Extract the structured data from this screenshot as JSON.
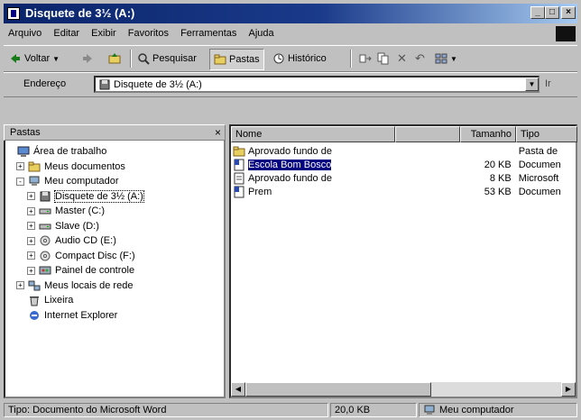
{
  "window": {
    "title": "Disquete de 3½ (A:)"
  },
  "titlebar_buttons": {
    "minimize": "_",
    "maximize": "□",
    "close": "×"
  },
  "menu": [
    "Arquivo",
    "Editar",
    "Exibir",
    "Favoritos",
    "Ferramentas",
    "Ajuda"
  ],
  "toolbar": {
    "back": "Voltar",
    "pesquisar": "Pesquisar",
    "pastas": "Pastas",
    "historico": "Histórico"
  },
  "address": {
    "label": "Endereço",
    "value": "Disquete de 3½ (A:)",
    "go": "Ir"
  },
  "folders_panel": {
    "title": "Pastas",
    "close": "×",
    "items": [
      {
        "label": "Área de trabalho",
        "icon": "desktop-icon",
        "level": 0,
        "expander": ""
      },
      {
        "label": "Meus documentos",
        "icon": "folder-icon",
        "level": 1,
        "expander": "+"
      },
      {
        "label": "Meu computador",
        "icon": "computer-icon",
        "level": 1,
        "expander": "-"
      },
      {
        "label": "Disquete de 3½ (A:)",
        "icon": "floppy-icon",
        "level": 2,
        "expander": "+"
      },
      {
        "label": "Master (C:)",
        "icon": "drive-icon",
        "level": 2,
        "expander": "+"
      },
      {
        "label": "Slave (D:)",
        "icon": "drive-icon",
        "level": 2,
        "expander": "+"
      },
      {
        "label": "Audio CD (E:)",
        "icon": "cd-icon",
        "level": 2,
        "expander": "+"
      },
      {
        "label": "Compact Disc (F:)",
        "icon": "cd-icon",
        "level": 2,
        "expander": "+"
      },
      {
        "label": "Painel de controle",
        "icon": "control-panel-icon",
        "level": 2,
        "expander": "+"
      },
      {
        "label": "Meus locais de rede",
        "icon": "network-icon",
        "level": 1,
        "expander": "+"
      },
      {
        "label": "Lixeira",
        "icon": "recycle-bin-icon",
        "level": 1,
        "expander": ""
      },
      {
        "label": "Internet Explorer",
        "icon": "ie-icon",
        "level": 1,
        "expander": ""
      }
    ]
  },
  "files": {
    "columns": [
      "Nome",
      "Tamanho",
      "Tipo"
    ],
    "rows": [
      {
        "name": "Aprovado fundo de",
        "size": "",
        "type": "Pasta de",
        "icon": "folder-icon",
        "selected": false
      },
      {
        "name": "Escola Bom Bosco",
        "size": "20 KB",
        "type": "Documen",
        "icon": "word-icon",
        "selected": true
      },
      {
        "name": "Aprovado fundo de",
        "size": "8 KB",
        "type": "Microsoft",
        "icon": "doc-icon",
        "selected": false
      },
      {
        "name": "Prem",
        "size": "53 KB",
        "type": "Documen",
        "icon": "word-icon",
        "selected": false
      }
    ]
  },
  "status": {
    "left": "Tipo: Documento do Microsoft Word",
    "middle": "20,0 KB",
    "right": "Meu computador"
  },
  "colors": {
    "titlebar": "#0a246a",
    "selection": "#000080"
  }
}
